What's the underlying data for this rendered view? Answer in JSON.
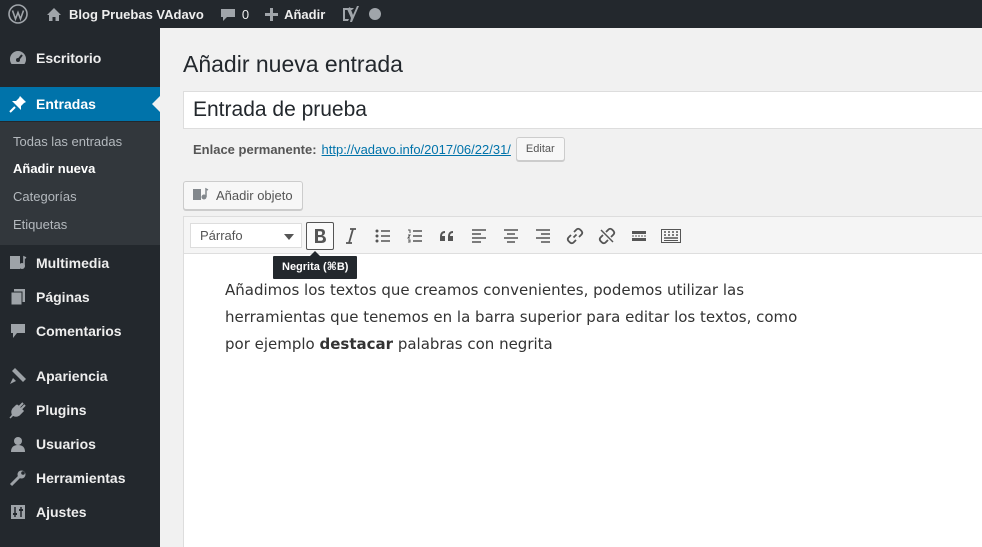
{
  "admin_bar": {
    "site_name": "Blog Pruebas VAdavo",
    "comments_count": "0",
    "new_label": "Añadir"
  },
  "sidebar": {
    "items": [
      {
        "label": "Escritorio",
        "icon": "dashboard-icon"
      },
      {
        "label": "Entradas",
        "icon": "pin-icon",
        "active": true
      },
      {
        "label": "Multimedia",
        "icon": "media-icon"
      },
      {
        "label": "Páginas",
        "icon": "pages-icon"
      },
      {
        "label": "Comentarios",
        "icon": "comments-icon"
      },
      {
        "label": "Apariencia",
        "icon": "appearance-icon"
      },
      {
        "label": "Plugins",
        "icon": "plugins-icon"
      },
      {
        "label": "Usuarios",
        "icon": "users-icon"
      },
      {
        "label": "Herramientas",
        "icon": "tools-icon"
      },
      {
        "label": "Ajustes",
        "icon": "settings-icon"
      }
    ],
    "submenu": [
      {
        "label": "Todas las entradas"
      },
      {
        "label": "Añadir nueva",
        "current": true
      },
      {
        "label": "Categorías"
      },
      {
        "label": "Etiquetas"
      }
    ]
  },
  "main": {
    "page_title": "Añadir nueva entrada",
    "post_title": "Entrada de prueba",
    "permalink_label": "Enlace permanente:",
    "permalink_url": "http://vadavo.info/2017/06/22/31/",
    "edit_button": "Editar",
    "add_media_button": "Añadir objeto"
  },
  "editor": {
    "format_select": "Párrafo",
    "tooltip": "Negrita (⌘B)",
    "content": {
      "before": "Añadimos los textos que creamos convenientes, podemos utilizar las herramientas que tenemos en la barra superior para editar los textos, como por ejemplo ",
      "bold": "destacar",
      "after": " palabras con negrita"
    }
  },
  "colors": {
    "admin_bar": "#23282d",
    "sidebar": "#23282d",
    "submenu": "#32373c",
    "active_item": "#0073aa",
    "link": "#0073aa",
    "background": "#f1f1f1"
  }
}
